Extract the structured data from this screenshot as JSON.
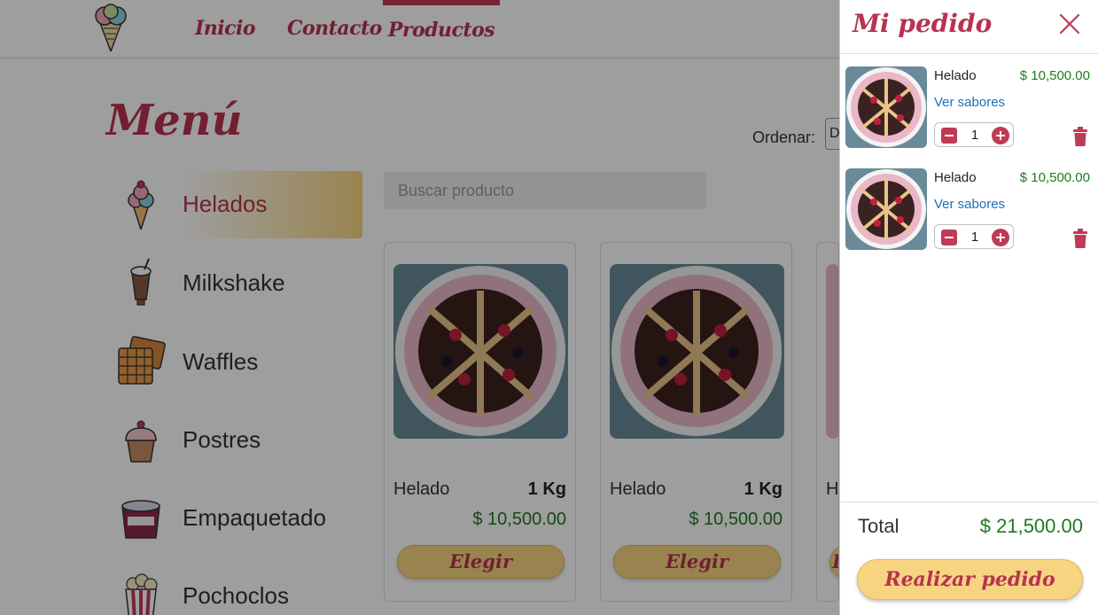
{
  "header": {
    "logo_text": "Ice Cream",
    "nav": [
      {
        "label": "Inicio"
      },
      {
        "label": "Contacto"
      },
      {
        "label": "Productos",
        "active": true
      }
    ]
  },
  "main": {
    "title": "Menú",
    "sort_label": "Ordenar:",
    "sort_value": "D",
    "search_placeholder": "Buscar producto",
    "categories": [
      {
        "label": "Helados",
        "icon": "ice-cream-icon",
        "active": true
      },
      {
        "label": "Milkshake",
        "icon": "milkshake-icon"
      },
      {
        "label": "Waffles",
        "icon": "waffle-icon"
      },
      {
        "label": "Postres",
        "icon": "cupcake-icon"
      },
      {
        "label": "Empaquetado",
        "icon": "packaged-tub-icon"
      },
      {
        "label": "Pochoclos",
        "icon": "popcorn-icon"
      }
    ],
    "products": [
      {
        "name": "Helado",
        "weight": "1 Kg",
        "price": "$ 10,500.00",
        "button": "Elegir"
      },
      {
        "name": "Helado",
        "weight": "1 Kg",
        "price": "$ 10,500.00",
        "button": "Elegir"
      },
      {
        "name": "H",
        "weight": "",
        "price": "",
        "button": "E"
      }
    ]
  },
  "cart": {
    "title": "Mi pedido",
    "items": [
      {
        "name": "Helado",
        "price": "$ 10,500.00",
        "flavors_link": "Ver sabores",
        "qty": "1"
      },
      {
        "name": "Helado",
        "price": "$ 10,500.00",
        "flavors_link": "Ver sabores",
        "qty": "1"
      }
    ],
    "total_label": "Total",
    "total_value": "$ 21,500.00",
    "order_button": "Realizar pedido"
  },
  "colors": {
    "brand": "#b8334f",
    "accent": "#f7d580",
    "price": "#1f7a1f",
    "link": "#1a6fb8"
  }
}
